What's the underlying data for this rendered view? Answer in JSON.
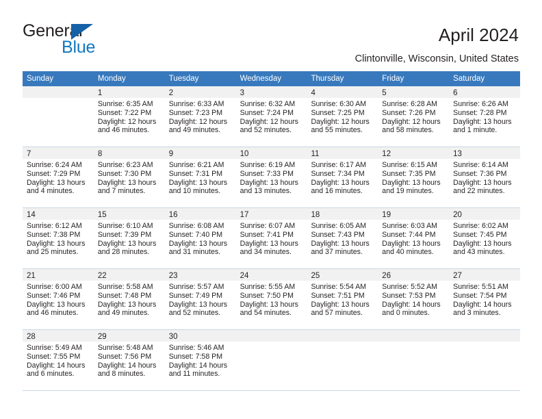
{
  "brand": {
    "name_part1": "General",
    "name_part2": "Blue",
    "logo_icon": "triangle-logo",
    "colors": {
      "dark": "#231f20",
      "blue": "#1278be",
      "triangle": "#1660a8"
    }
  },
  "header": {
    "title": "April 2024",
    "subtitle": "Clintonville, Wisconsin, United States"
  },
  "calendar": {
    "header_bg": "#3879bd",
    "weekdays": [
      "Sunday",
      "Monday",
      "Tuesday",
      "Wednesday",
      "Thursday",
      "Friday",
      "Saturday"
    ],
    "weeks": [
      [
        {
          "day": "",
          "empty": true,
          "sunrise": "",
          "sunset": "",
          "daylight1": "",
          "daylight2": ""
        },
        {
          "day": "1",
          "sunrise": "Sunrise: 6:35 AM",
          "sunset": "Sunset: 7:22 PM",
          "daylight1": "Daylight: 12 hours",
          "daylight2": "and 46 minutes."
        },
        {
          "day": "2",
          "sunrise": "Sunrise: 6:33 AM",
          "sunset": "Sunset: 7:23 PM",
          "daylight1": "Daylight: 12 hours",
          "daylight2": "and 49 minutes."
        },
        {
          "day": "3",
          "sunrise": "Sunrise: 6:32 AM",
          "sunset": "Sunset: 7:24 PM",
          "daylight1": "Daylight: 12 hours",
          "daylight2": "and 52 minutes."
        },
        {
          "day": "4",
          "sunrise": "Sunrise: 6:30 AM",
          "sunset": "Sunset: 7:25 PM",
          "daylight1": "Daylight: 12 hours",
          "daylight2": "and 55 minutes."
        },
        {
          "day": "5",
          "sunrise": "Sunrise: 6:28 AM",
          "sunset": "Sunset: 7:26 PM",
          "daylight1": "Daylight: 12 hours",
          "daylight2": "and 58 minutes."
        },
        {
          "day": "6",
          "sunrise": "Sunrise: 6:26 AM",
          "sunset": "Sunset: 7:28 PM",
          "daylight1": "Daylight: 13 hours",
          "daylight2": "and 1 minute."
        }
      ],
      [
        {
          "day": "7",
          "sunrise": "Sunrise: 6:24 AM",
          "sunset": "Sunset: 7:29 PM",
          "daylight1": "Daylight: 13 hours",
          "daylight2": "and 4 minutes."
        },
        {
          "day": "8",
          "sunrise": "Sunrise: 6:23 AM",
          "sunset": "Sunset: 7:30 PM",
          "daylight1": "Daylight: 13 hours",
          "daylight2": "and 7 minutes."
        },
        {
          "day": "9",
          "sunrise": "Sunrise: 6:21 AM",
          "sunset": "Sunset: 7:31 PM",
          "daylight1": "Daylight: 13 hours",
          "daylight2": "and 10 minutes."
        },
        {
          "day": "10",
          "sunrise": "Sunrise: 6:19 AM",
          "sunset": "Sunset: 7:33 PM",
          "daylight1": "Daylight: 13 hours",
          "daylight2": "and 13 minutes."
        },
        {
          "day": "11",
          "sunrise": "Sunrise: 6:17 AM",
          "sunset": "Sunset: 7:34 PM",
          "daylight1": "Daylight: 13 hours",
          "daylight2": "and 16 minutes."
        },
        {
          "day": "12",
          "sunrise": "Sunrise: 6:15 AM",
          "sunset": "Sunset: 7:35 PM",
          "daylight1": "Daylight: 13 hours",
          "daylight2": "and 19 minutes."
        },
        {
          "day": "13",
          "sunrise": "Sunrise: 6:14 AM",
          "sunset": "Sunset: 7:36 PM",
          "daylight1": "Daylight: 13 hours",
          "daylight2": "and 22 minutes."
        }
      ],
      [
        {
          "day": "14",
          "sunrise": "Sunrise: 6:12 AM",
          "sunset": "Sunset: 7:38 PM",
          "daylight1": "Daylight: 13 hours",
          "daylight2": "and 25 minutes."
        },
        {
          "day": "15",
          "sunrise": "Sunrise: 6:10 AM",
          "sunset": "Sunset: 7:39 PM",
          "daylight1": "Daylight: 13 hours",
          "daylight2": "and 28 minutes."
        },
        {
          "day": "16",
          "sunrise": "Sunrise: 6:08 AM",
          "sunset": "Sunset: 7:40 PM",
          "daylight1": "Daylight: 13 hours",
          "daylight2": "and 31 minutes."
        },
        {
          "day": "17",
          "sunrise": "Sunrise: 6:07 AM",
          "sunset": "Sunset: 7:41 PM",
          "daylight1": "Daylight: 13 hours",
          "daylight2": "and 34 minutes."
        },
        {
          "day": "18",
          "sunrise": "Sunrise: 6:05 AM",
          "sunset": "Sunset: 7:43 PM",
          "daylight1": "Daylight: 13 hours",
          "daylight2": "and 37 minutes."
        },
        {
          "day": "19",
          "sunrise": "Sunrise: 6:03 AM",
          "sunset": "Sunset: 7:44 PM",
          "daylight1": "Daylight: 13 hours",
          "daylight2": "and 40 minutes."
        },
        {
          "day": "20",
          "sunrise": "Sunrise: 6:02 AM",
          "sunset": "Sunset: 7:45 PM",
          "daylight1": "Daylight: 13 hours",
          "daylight2": "and 43 minutes."
        }
      ],
      [
        {
          "day": "21",
          "sunrise": "Sunrise: 6:00 AM",
          "sunset": "Sunset: 7:46 PM",
          "daylight1": "Daylight: 13 hours",
          "daylight2": "and 46 minutes."
        },
        {
          "day": "22",
          "sunrise": "Sunrise: 5:58 AM",
          "sunset": "Sunset: 7:48 PM",
          "daylight1": "Daylight: 13 hours",
          "daylight2": "and 49 minutes."
        },
        {
          "day": "23",
          "sunrise": "Sunrise: 5:57 AM",
          "sunset": "Sunset: 7:49 PM",
          "daylight1": "Daylight: 13 hours",
          "daylight2": "and 52 minutes."
        },
        {
          "day": "24",
          "sunrise": "Sunrise: 5:55 AM",
          "sunset": "Sunset: 7:50 PM",
          "daylight1": "Daylight: 13 hours",
          "daylight2": "and 54 minutes."
        },
        {
          "day": "25",
          "sunrise": "Sunrise: 5:54 AM",
          "sunset": "Sunset: 7:51 PM",
          "daylight1": "Daylight: 13 hours",
          "daylight2": "and 57 minutes."
        },
        {
          "day": "26",
          "sunrise": "Sunrise: 5:52 AM",
          "sunset": "Sunset: 7:53 PM",
          "daylight1": "Daylight: 14 hours",
          "daylight2": "and 0 minutes."
        },
        {
          "day": "27",
          "sunrise": "Sunrise: 5:51 AM",
          "sunset": "Sunset: 7:54 PM",
          "daylight1": "Daylight: 14 hours",
          "daylight2": "and 3 minutes."
        }
      ],
      [
        {
          "day": "28",
          "sunrise": "Sunrise: 5:49 AM",
          "sunset": "Sunset: 7:55 PM",
          "daylight1": "Daylight: 14 hours",
          "daylight2": "and 6 minutes."
        },
        {
          "day": "29",
          "sunrise": "Sunrise: 5:48 AM",
          "sunset": "Sunset: 7:56 PM",
          "daylight1": "Daylight: 14 hours",
          "daylight2": "and 8 minutes."
        },
        {
          "day": "30",
          "sunrise": "Sunrise: 5:46 AM",
          "sunset": "Sunset: 7:58 PM",
          "daylight1": "Daylight: 14 hours",
          "daylight2": "and 11 minutes."
        },
        {
          "day": "",
          "empty": true,
          "sunrise": "",
          "sunset": "",
          "daylight1": "",
          "daylight2": ""
        },
        {
          "day": "",
          "empty": true,
          "sunrise": "",
          "sunset": "",
          "daylight1": "",
          "daylight2": ""
        },
        {
          "day": "",
          "empty": true,
          "sunrise": "",
          "sunset": "",
          "daylight1": "",
          "daylight2": ""
        },
        {
          "day": "",
          "empty": true,
          "sunrise": "",
          "sunset": "",
          "daylight1": "",
          "daylight2": ""
        }
      ]
    ]
  }
}
